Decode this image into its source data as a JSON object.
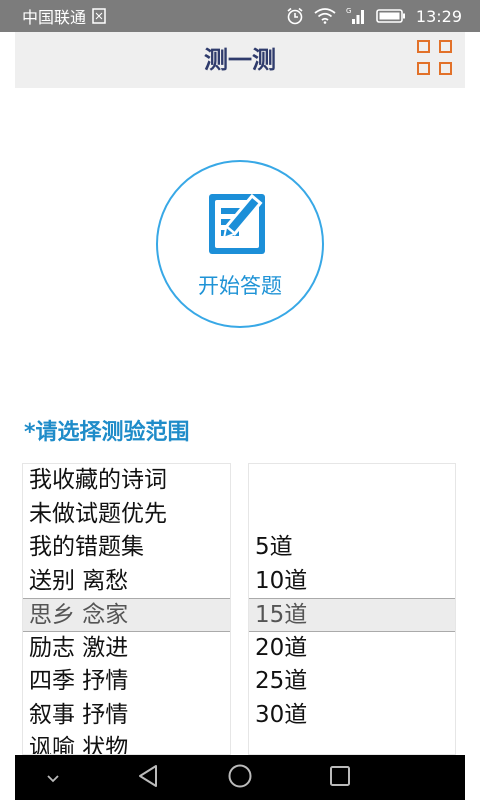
{
  "status_bar": {
    "carrier": "中国联通",
    "time": "13:29",
    "icons": [
      "sim-icon",
      "alarm-icon",
      "wifi-icon",
      "signal-icon",
      "battery-icon"
    ]
  },
  "header": {
    "title": "测一测",
    "menu_icon": "grid-menu-icon",
    "accent_color": "#e27129"
  },
  "start_button": {
    "label": "开始答题",
    "icon": "edit-icon",
    "color": "#38a8e6"
  },
  "range_label": "*请选择测验范围",
  "category_picker": {
    "items": [
      "我收藏的诗词",
      "未做试题优先",
      "我的错题集",
      "送别 离愁",
      "思乡 念家",
      "励志 激进",
      "四季 抒情",
      "叙事 抒情",
      "讽喻 状物"
    ],
    "selected": "思乡 念家"
  },
  "count_picker": {
    "items": [
      "5道",
      "10道",
      "15道",
      "20道",
      "25道",
      "30道"
    ],
    "selected": "15道"
  },
  "nav_bar": {
    "icons": [
      "hide-keyboard-icon",
      "back-icon",
      "home-icon",
      "recents-icon"
    ]
  }
}
